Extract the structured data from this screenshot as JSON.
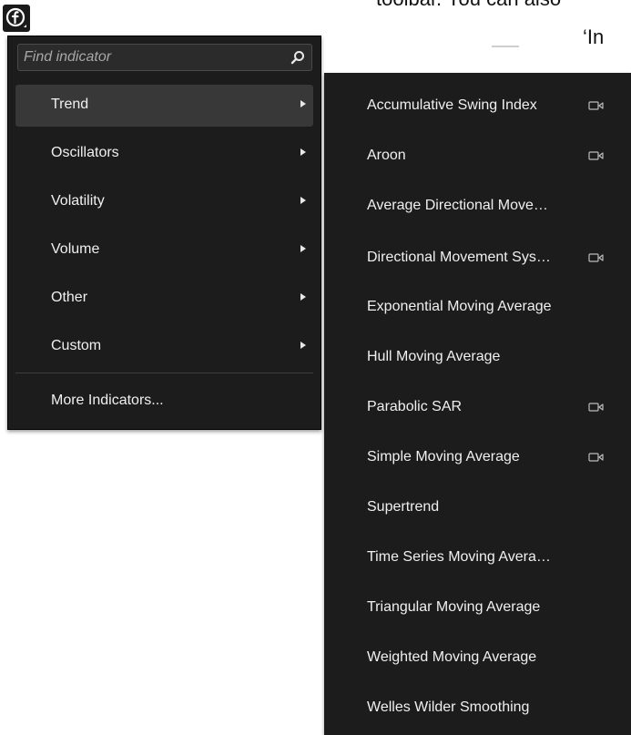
{
  "background_doc": {
    "line1": "toolbar. You can also",
    "line2": "‘In"
  },
  "trigger": {
    "icon": "indicator-f-icon"
  },
  "search": {
    "placeholder": "Find indicator",
    "value": ""
  },
  "categories": [
    {
      "label": "Trend",
      "active": true
    },
    {
      "label": "Oscillators",
      "active": false
    },
    {
      "label": "Volatility",
      "active": false
    },
    {
      "label": "Volume",
      "active": false
    },
    {
      "label": "Other",
      "active": false
    },
    {
      "label": "Custom",
      "active": false
    }
  ],
  "more_indicators": "More Indicators...",
  "submenu": [
    {
      "label": "Accumulative Swing Index",
      "video": true
    },
    {
      "label": "Aroon",
      "video": true
    },
    {
      "label": "Average Directional Move…",
      "video": false
    },
    {
      "label": "Directional Movement Sys…",
      "video": true
    },
    {
      "label": "Exponential Moving Average",
      "video": false
    },
    {
      "label": "Hull Moving Average",
      "video": false
    },
    {
      "label": "Parabolic SAR",
      "video": true
    },
    {
      "label": "Simple Moving Average",
      "video": true
    },
    {
      "label": "Supertrend",
      "video": false
    },
    {
      "label": "Time Series Moving Avera…",
      "video": false
    },
    {
      "label": "Triangular Moving Average",
      "video": false
    },
    {
      "label": "Weighted Moving Average",
      "video": false
    },
    {
      "label": "Welles Wilder Smoothing",
      "video": false
    }
  ],
  "colors": {
    "menu_bg": "#1c1c1c",
    "active_bg": "#383838",
    "text": "#f0f0f0"
  }
}
